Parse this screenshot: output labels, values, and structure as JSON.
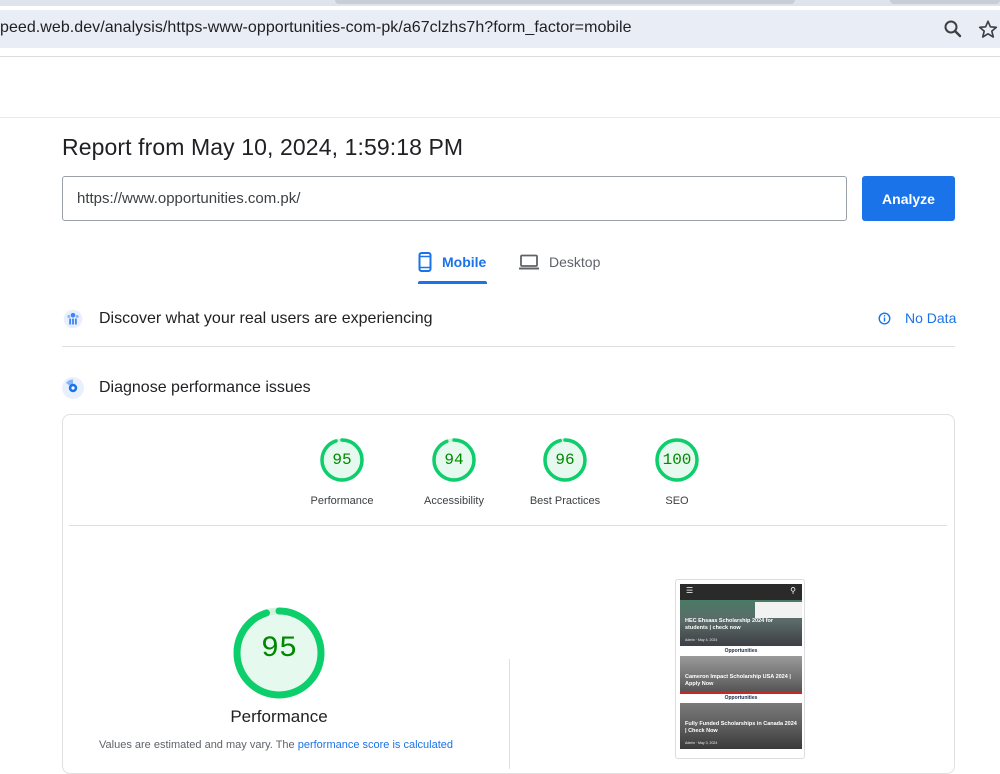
{
  "browser": {
    "url": "peed.web.dev/analysis/https-www-opportunities-com-pk/a67clzhs7h?form_factor=mobile",
    "zoom_icon": "zoom-icon",
    "bookmark_icon": "star-icon"
  },
  "report": {
    "title": "Report from May 10, 2024, 1:59:18 PM",
    "url_value": "https://www.opportunities.com.pk/",
    "analyze_label": "Analyze"
  },
  "device_tabs": {
    "mobile": {
      "label": "Mobile",
      "icon": "smartphone-icon",
      "selected": true
    },
    "desktop": {
      "label": "Desktop",
      "icon": "laptop-icon",
      "selected": false
    }
  },
  "sections": {
    "real_users": {
      "label": "Discover what your real users are experiencing",
      "icon": "crux-users-icon",
      "status": "No Data",
      "status_icon": "info-icon"
    },
    "diagnose": {
      "label": "Diagnose performance issues",
      "icon": "lighthouse-icon"
    }
  },
  "scores": [
    {
      "label": "Performance",
      "value": "95",
      "fraction": 0.95
    },
    {
      "label": "Accessibility",
      "value": "94",
      "fraction": 0.94
    },
    {
      "label": "Best Practices",
      "value": "96",
      "fraction": 0.96
    },
    {
      "label": "SEO",
      "value": "100",
      "fraction": 1.0
    }
  ],
  "performance_detail": {
    "value": "95",
    "fraction": 0.95,
    "label": "Performance",
    "note_prefix": "Values are estimated and may vary. The ",
    "note_link": "performance score is calculated"
  },
  "screenshot": {
    "cards": [
      {
        "title": "HEC Ehsaas Scholarship 2024 for students | check now",
        "meta": "Admin · May 4, 2024"
      },
      {
        "title": "Cameron Impact Scholarship USA 2024 | Apply Now",
        "meta": "Admin · May 4, 2024"
      },
      {
        "title": "Fully Funded Scholarships in Canada 2024 | Check Now",
        "meta": "Admin · May 3, 2024"
      }
    ],
    "brand": "Opportunities"
  },
  "colors": {
    "accent": "#1a73e8",
    "pass": "#0cce6b",
    "pass_text": "#008800"
  }
}
